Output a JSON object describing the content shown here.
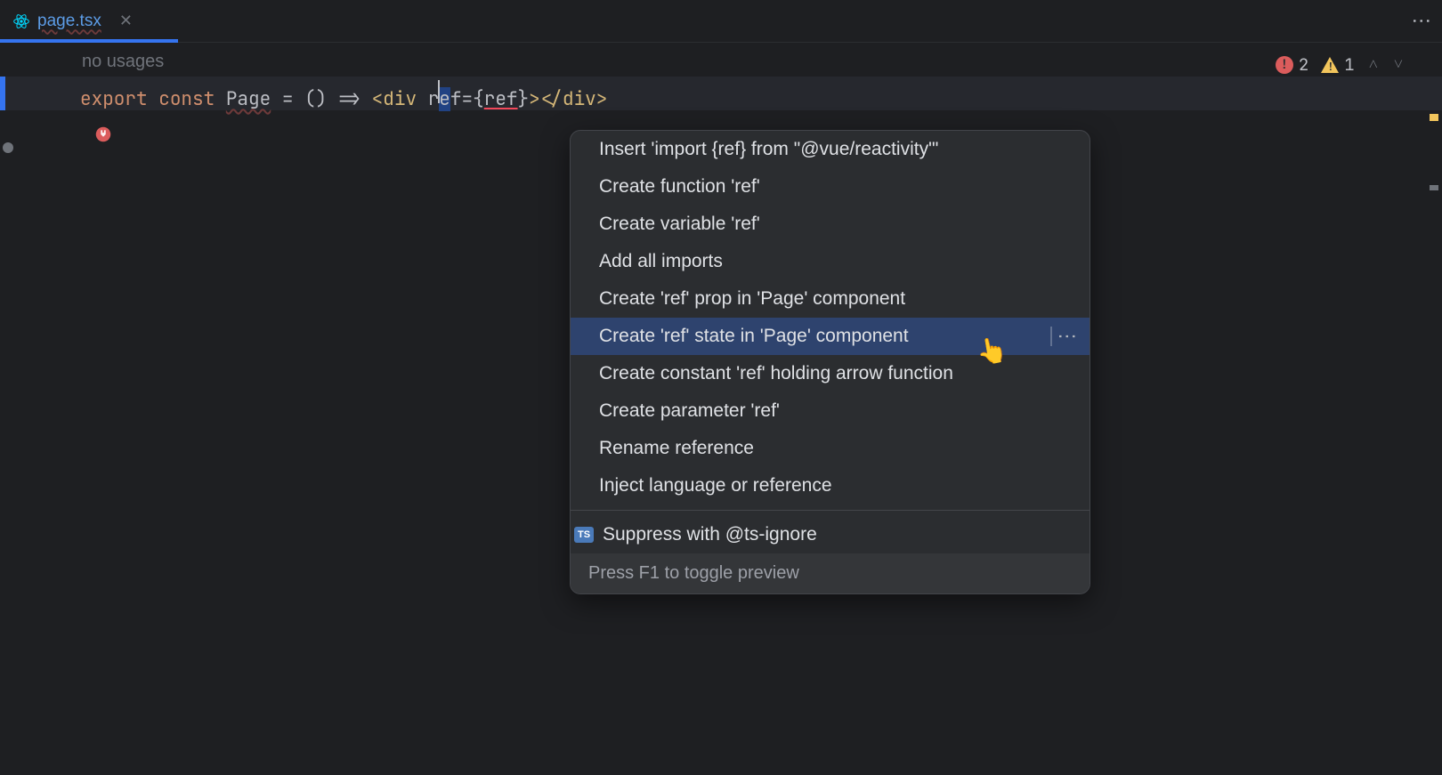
{
  "tab": {
    "filename": "page.tsx"
  },
  "usages": {
    "label": "no usages"
  },
  "code": {
    "kw_export": "export",
    "kw_const": "const",
    "ident": "Page",
    "eq": " = ",
    "parens": "()",
    "arrow": " => ",
    "open_tag": "<",
    "tag_name": "div",
    "space": " ",
    "attr_pre_caret": "r",
    "attr_post_caret": "e",
    "attr_rest": "f",
    "eq2": "=",
    "brace_open": "{",
    "ref_ident": "ref",
    "brace_close": "}",
    "close1": ">",
    "close_open": "</",
    "close2": ">"
  },
  "problems": {
    "errors": "2",
    "warnings": "1"
  },
  "popup": {
    "items": [
      "Insert 'import {ref} from \"@vue/reactivity\"'",
      "Create function 'ref'",
      "Create variable 'ref'",
      "Add all imports",
      "Create 'ref' prop in 'Page' component",
      "Create 'ref' state in 'Page' component",
      "Create constant 'ref' holding arrow function",
      "Create parameter 'ref'",
      "Rename reference",
      "Inject language or reference"
    ],
    "selected_index": 5,
    "suppress_label": "Suppress with @ts-ignore",
    "ts_badge": "TS",
    "footer": "Press F1 to toggle preview"
  }
}
